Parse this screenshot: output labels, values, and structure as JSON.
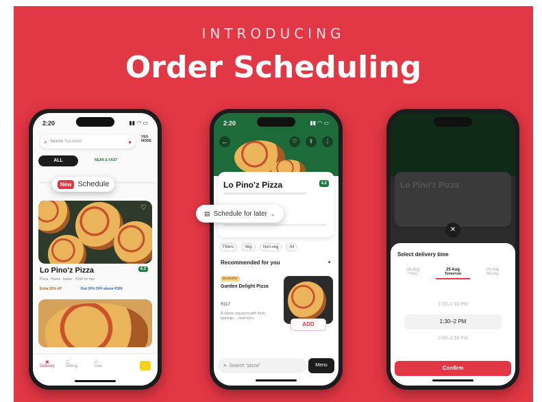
{
  "banner": {
    "kicker": "INTRODUCING",
    "headline": "Order Scheduling"
  },
  "phone1": {
    "time": "2:20",
    "search_placeholder": "Search \"Lo crisis\"",
    "veg_label": "VEG MODE",
    "tab_all": "ALL",
    "tab_fast": "NEAR & FAST",
    "new_badge": "New",
    "schedule_label": "Schedule",
    "rest_name": "Lo Pino'z Pizza",
    "rating": "4.2",
    "meta": "Pizza · Pasta · Italian · ₹200 for one",
    "offer1": "Extra 20% off",
    "offer2": "Flat 30% OFF above ₹399",
    "nav": [
      "Delivery",
      "Dining",
      "Live"
    ]
  },
  "phone2": {
    "time": "2:20",
    "rest_name": "Lo Pino'z Pizza",
    "rating": "4.2",
    "schedule_chip": "Schedule for later",
    "filters": [
      "Filters",
      "Veg",
      "Non-veg",
      "All"
    ],
    "section": "Recommended for you",
    "item_tag": "Bestseller",
    "item_name": "Garden Delight Pizza",
    "item_price": "₹217",
    "item_desc": "A classic veg pizza with fresh toppings ... read more",
    "add_label": "ADD",
    "search_placeholder": "Search \"pizza\"",
    "menu_label": "Menu"
  },
  "phone3": {
    "rest_name": "Lo Pino'z Pizza",
    "sheet_title": "Select delivery time",
    "dates": [
      {
        "day": "24 Aug",
        "sub": "Today"
      },
      {
        "day": "25 Aug",
        "sub": "Tomorrow"
      },
      {
        "day": "26 Aug",
        "sub": "Monday"
      }
    ],
    "slots": [
      "1:00–1:30 PM",
      "1:30–2 PM",
      "2:00–2:30 PM"
    ],
    "cta": "Confirm"
  },
  "colors": {
    "brand": "#e23744",
    "green": "#1f7a3d"
  }
}
